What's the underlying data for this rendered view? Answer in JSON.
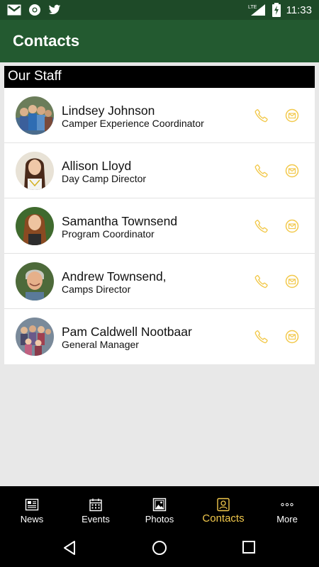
{
  "status_bar": {
    "time": "11:33",
    "network": "LTE"
  },
  "app_bar": {
    "title": "Contacts"
  },
  "section": {
    "title": "Our Staff"
  },
  "colors": {
    "app_bar": "#235a30",
    "status_bar": "#1e4a28",
    "accent": "#f2c94c"
  },
  "contacts": [
    {
      "name": "Lindsey Johnson",
      "role": "Camper Experience Coordinator"
    },
    {
      "name": "Allison Lloyd",
      "role": "Day Camp Director"
    },
    {
      "name": "Samantha Townsend",
      "role": "Program Coordinator"
    },
    {
      "name": "Andrew Townsend,",
      "role": "Camps Director"
    },
    {
      "name": "Pam Caldwell Nootbaar",
      "role": "General Manager"
    }
  ],
  "nav": {
    "items": [
      {
        "label": "News",
        "icon": "newspaper-icon"
      },
      {
        "label": "Events",
        "icon": "calendar-icon"
      },
      {
        "label": "Photos",
        "icon": "photo-icon"
      },
      {
        "label": "Contacts",
        "icon": "contact-card-icon",
        "active": true
      },
      {
        "label": "More",
        "icon": "more-dots-icon"
      }
    ]
  }
}
